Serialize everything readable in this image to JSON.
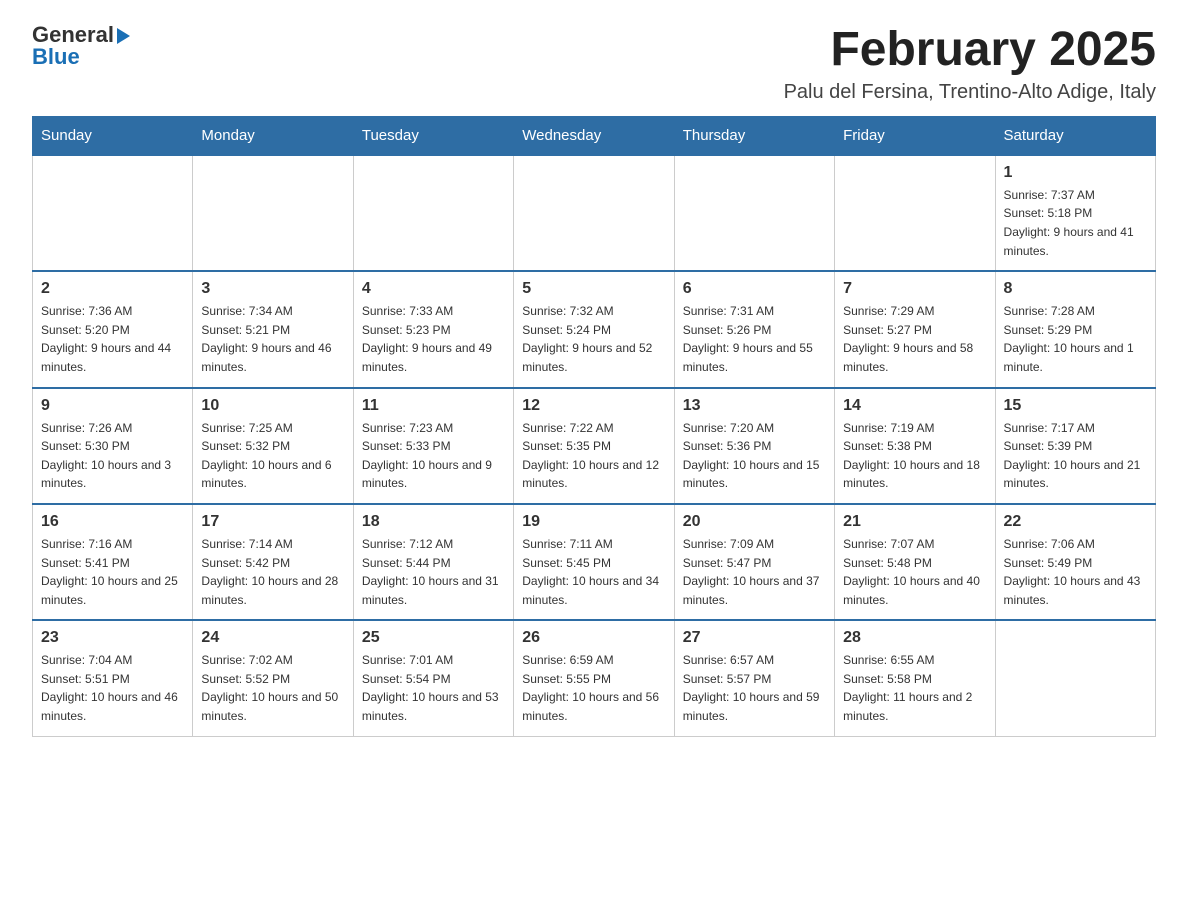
{
  "header": {
    "logo_general": "General",
    "logo_blue": "Blue",
    "month_title": "February 2025",
    "location": "Palu del Fersina, Trentino-Alto Adige, Italy"
  },
  "weekdays": [
    "Sunday",
    "Monday",
    "Tuesday",
    "Wednesday",
    "Thursday",
    "Friday",
    "Saturday"
  ],
  "weeks": [
    [
      {
        "day": "",
        "info": ""
      },
      {
        "day": "",
        "info": ""
      },
      {
        "day": "",
        "info": ""
      },
      {
        "day": "",
        "info": ""
      },
      {
        "day": "",
        "info": ""
      },
      {
        "day": "",
        "info": ""
      },
      {
        "day": "1",
        "info": "Sunrise: 7:37 AM\nSunset: 5:18 PM\nDaylight: 9 hours and 41 minutes."
      }
    ],
    [
      {
        "day": "2",
        "info": "Sunrise: 7:36 AM\nSunset: 5:20 PM\nDaylight: 9 hours and 44 minutes."
      },
      {
        "day": "3",
        "info": "Sunrise: 7:34 AM\nSunset: 5:21 PM\nDaylight: 9 hours and 46 minutes."
      },
      {
        "day": "4",
        "info": "Sunrise: 7:33 AM\nSunset: 5:23 PM\nDaylight: 9 hours and 49 minutes."
      },
      {
        "day": "5",
        "info": "Sunrise: 7:32 AM\nSunset: 5:24 PM\nDaylight: 9 hours and 52 minutes."
      },
      {
        "day": "6",
        "info": "Sunrise: 7:31 AM\nSunset: 5:26 PM\nDaylight: 9 hours and 55 minutes."
      },
      {
        "day": "7",
        "info": "Sunrise: 7:29 AM\nSunset: 5:27 PM\nDaylight: 9 hours and 58 minutes."
      },
      {
        "day": "8",
        "info": "Sunrise: 7:28 AM\nSunset: 5:29 PM\nDaylight: 10 hours and 1 minute."
      }
    ],
    [
      {
        "day": "9",
        "info": "Sunrise: 7:26 AM\nSunset: 5:30 PM\nDaylight: 10 hours and 3 minutes."
      },
      {
        "day": "10",
        "info": "Sunrise: 7:25 AM\nSunset: 5:32 PM\nDaylight: 10 hours and 6 minutes."
      },
      {
        "day": "11",
        "info": "Sunrise: 7:23 AM\nSunset: 5:33 PM\nDaylight: 10 hours and 9 minutes."
      },
      {
        "day": "12",
        "info": "Sunrise: 7:22 AM\nSunset: 5:35 PM\nDaylight: 10 hours and 12 minutes."
      },
      {
        "day": "13",
        "info": "Sunrise: 7:20 AM\nSunset: 5:36 PM\nDaylight: 10 hours and 15 minutes."
      },
      {
        "day": "14",
        "info": "Sunrise: 7:19 AM\nSunset: 5:38 PM\nDaylight: 10 hours and 18 minutes."
      },
      {
        "day": "15",
        "info": "Sunrise: 7:17 AM\nSunset: 5:39 PM\nDaylight: 10 hours and 21 minutes."
      }
    ],
    [
      {
        "day": "16",
        "info": "Sunrise: 7:16 AM\nSunset: 5:41 PM\nDaylight: 10 hours and 25 minutes."
      },
      {
        "day": "17",
        "info": "Sunrise: 7:14 AM\nSunset: 5:42 PM\nDaylight: 10 hours and 28 minutes."
      },
      {
        "day": "18",
        "info": "Sunrise: 7:12 AM\nSunset: 5:44 PM\nDaylight: 10 hours and 31 minutes."
      },
      {
        "day": "19",
        "info": "Sunrise: 7:11 AM\nSunset: 5:45 PM\nDaylight: 10 hours and 34 minutes."
      },
      {
        "day": "20",
        "info": "Sunrise: 7:09 AM\nSunset: 5:47 PM\nDaylight: 10 hours and 37 minutes."
      },
      {
        "day": "21",
        "info": "Sunrise: 7:07 AM\nSunset: 5:48 PM\nDaylight: 10 hours and 40 minutes."
      },
      {
        "day": "22",
        "info": "Sunrise: 7:06 AM\nSunset: 5:49 PM\nDaylight: 10 hours and 43 minutes."
      }
    ],
    [
      {
        "day": "23",
        "info": "Sunrise: 7:04 AM\nSunset: 5:51 PM\nDaylight: 10 hours and 46 minutes."
      },
      {
        "day": "24",
        "info": "Sunrise: 7:02 AM\nSunset: 5:52 PM\nDaylight: 10 hours and 50 minutes."
      },
      {
        "day": "25",
        "info": "Sunrise: 7:01 AM\nSunset: 5:54 PM\nDaylight: 10 hours and 53 minutes."
      },
      {
        "day": "26",
        "info": "Sunrise: 6:59 AM\nSunset: 5:55 PM\nDaylight: 10 hours and 56 minutes."
      },
      {
        "day": "27",
        "info": "Sunrise: 6:57 AM\nSunset: 5:57 PM\nDaylight: 10 hours and 59 minutes."
      },
      {
        "day": "28",
        "info": "Sunrise: 6:55 AM\nSunset: 5:58 PM\nDaylight: 11 hours and 2 minutes."
      },
      {
        "day": "",
        "info": ""
      }
    ]
  ]
}
